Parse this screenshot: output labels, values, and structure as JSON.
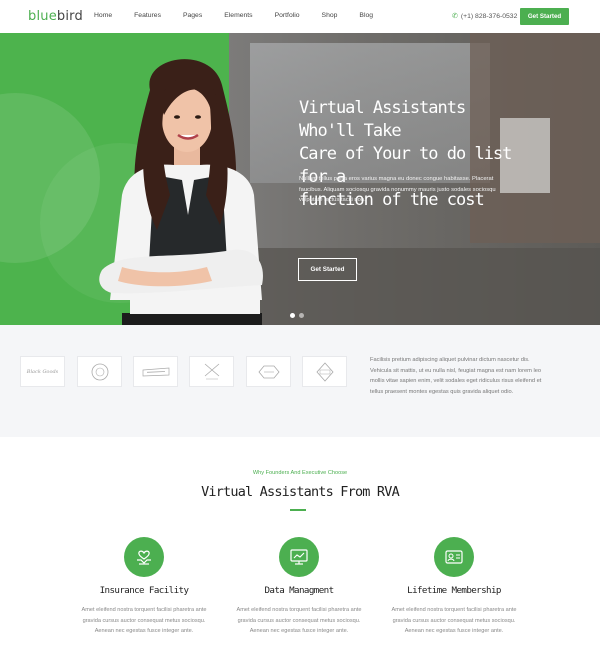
{
  "header": {
    "logo_part1": "blue",
    "logo_part2": "bird",
    "nav": [
      "Home",
      "Features",
      "Pages",
      "Elements",
      "Portfolio",
      "Shop",
      "Blog"
    ],
    "phone": "(+1) 828-376-0532",
    "cta": "Get Started"
  },
  "hero": {
    "title_line1": "Virtual Assistants Who'll Take",
    "title_line2": "Care of Your to do list for a",
    "title_line3": "function of the cost",
    "text_line1": "Nullam tellus porta eros varius magna eu donec congue habitasse. Placerat",
    "text_line2": "faucibus. Aliquam sociosqu gravida nonummy mauris justo sodales sociosqu",
    "text_line3": "vulputate lectus taciti non.",
    "button": "Get Started",
    "slides": 2,
    "active_slide": 1
  },
  "band": {
    "logos": [
      "Black Goods",
      "Emblem",
      "Banner",
      "Compass Co",
      "Badge",
      "Shield"
    ],
    "text_line1": "Facilisis pretium adipiscing aliquet pulvinar dictum nascetur dis.",
    "text_line2": "Vehicula sit mattis, ut eu nulla nisl, feugiat magna est nam lorem leo",
    "text_line3": "mollis vitae sapien enim, velit sodales eget ridiculus risus eleifend et",
    "text_line4": "tellus praesent montes egestas quis gravida aliquet odio."
  },
  "features": {
    "kicker": "Why Founders And Executive Choose",
    "title": "Virtual Assistants From RVA",
    "items": [
      {
        "icon": "hands-heart-icon",
        "title": "Insurance Facility",
        "line1": "Amet eleifend nostra torquent facilisi pharetra ante",
        "line2": "gravida cursus auctor consequat metus sociosqu.",
        "line3": "Aenean nec egestas fusce integer ante."
      },
      {
        "icon": "monitor-chart-icon",
        "title": "Data Managment",
        "line1": "Amet eleifend nostra torquent facilisi pharetra ante",
        "line2": "gravida cursus auctor consequat metus sociosqu.",
        "line3": "Aenean nec egestas fusce integer ante."
      },
      {
        "icon": "id-card-icon",
        "title": "Lifetime Membership",
        "line1": "Amet eleifend nostra torquent facilisi pharetra ante",
        "line2": "gravida cursus auctor consequat metus sociosqu.",
        "line3": "Aenean nec egestas fusce integer ante."
      }
    ]
  },
  "colors": {
    "accent": "#4caf50",
    "band_bg": "#f5f6f8"
  }
}
